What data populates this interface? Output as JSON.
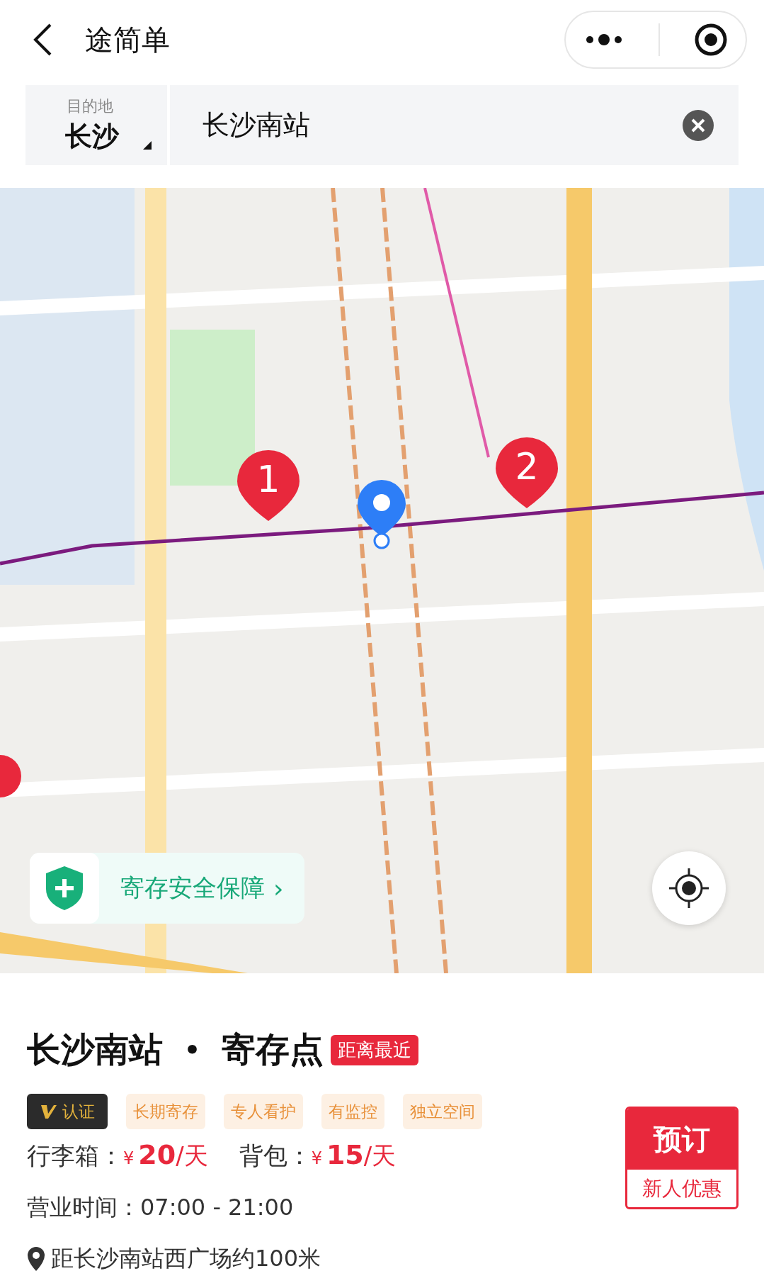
{
  "header": {
    "title": "途简单"
  },
  "search": {
    "city_label": "目的地",
    "city": "长沙",
    "value": "长沙南站"
  },
  "map": {
    "kind": "picture",
    "markers": [
      {
        "kind": "numbered",
        "label": "1"
      },
      {
        "kind": "numbered",
        "label": "2"
      },
      {
        "kind": "location"
      }
    ],
    "safety_badge": "寄存安全保障",
    "safety_arrow": "›"
  },
  "place": {
    "name": "长沙南站",
    "separator": "•",
    "type": "寄存点",
    "badge": "距离最近",
    "tags": [
      {
        "kind": "verified",
        "label": "认证"
      },
      {
        "kind": "feature",
        "label": "长期寄存"
      },
      {
        "kind": "feature",
        "label": "专人看护"
      },
      {
        "kind": "feature",
        "label": "有监控"
      },
      {
        "kind": "feature",
        "label": "独立空间"
      }
    ],
    "prices": [
      {
        "label": "行李箱：",
        "currency": "¥",
        "amount": "20",
        "unit": "/天"
      },
      {
        "label": "背包：",
        "currency": "¥",
        "amount": "15",
        "unit": "/天"
      }
    ],
    "hours": "营业时间：07:00 - 21:00",
    "distance": "距长沙南站西广场约100米",
    "book_button": {
      "title": "预订",
      "subtitle": "新人优惠"
    }
  }
}
